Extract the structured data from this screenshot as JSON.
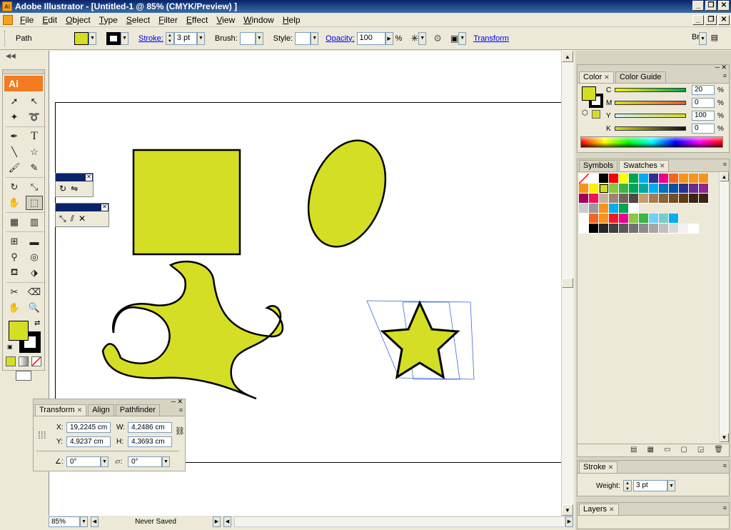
{
  "app": {
    "icon_text": "Ai",
    "title": "Adobe Illustrator - [Untitled-1 @ 85% (CMYK/Preview) ]"
  },
  "menu": [
    "File",
    "Edit",
    "Object",
    "Type",
    "Select",
    "Filter",
    "Effect",
    "View",
    "Window",
    "Help"
  ],
  "control_bar": {
    "selection": "Path",
    "stroke_label": "Stroke:",
    "stroke_value": "3 pt",
    "brush_label": "Brush:",
    "style_label": "Style:",
    "opacity_label": "Opacity:",
    "opacity_value": "100",
    "percent": "%",
    "transform_link": "Transform"
  },
  "colors": {
    "fill": "#d4de24",
    "stroke": "#000000",
    "accent": "#0a246a"
  },
  "tools": {
    "logo": "Ai",
    "icons": [
      "selection-tool",
      "direct-selection-tool",
      "magic-wand-tool",
      "lasso-tool",
      "pen-tool",
      "type-tool",
      "line-tool",
      "star-tool",
      "paintbrush-tool",
      "pencil-tool",
      "rotate-tool",
      "scale-tool",
      "warp-tool",
      "free-transform-tool",
      "symbol-sprayer-tool",
      "graph-tool",
      "mesh-tool",
      "gradient-tool",
      "eyedropper-tool",
      "blend-tool",
      "live-paint-tool",
      "live-paint-selection-tool",
      "slice-tool",
      "eraser-tool",
      "hand-tool",
      "zoom-tool"
    ]
  },
  "color_panel": {
    "tabs": [
      "Color",
      "Color Guide"
    ],
    "channels": [
      {
        "label": "C",
        "value": "20",
        "unit": "%"
      },
      {
        "label": "M",
        "value": "0",
        "unit": "%"
      },
      {
        "label": "Y",
        "value": "100",
        "unit": "%"
      },
      {
        "label": "K",
        "value": "0",
        "unit": "%"
      }
    ]
  },
  "swatches_panel": {
    "tabs": [
      "Symbols",
      "Swatches"
    ],
    "rows": [
      [
        "#ffffff",
        "#ffffff",
        "#000000",
        "#ff0000",
        "#ffff00",
        "#00a651",
        "#00aeef",
        "#2e3192",
        "#ec008c",
        "#f26522",
        "#f7941d",
        "#f7941d",
        "#f7941d"
      ],
      [
        "#f7941d",
        "#fff200",
        "#d4de24",
        "#8dc63f",
        "#39b54a",
        "#00a651",
        "#00a99d",
        "#00aeef",
        "#0072bc",
        "#0054a6",
        "#2e3192",
        "#662d91",
        "#92278f"
      ],
      [
        "#9e005d",
        "#ed145b",
        "#c7b299",
        "#998675",
        "#736357",
        "#534741",
        "#c69c6d",
        "#a67c52",
        "#8c6239",
        "#754c24",
        "#603913",
        "#3c2415",
        "#3c2415"
      ],
      [
        "#cccccc",
        "#999999",
        "#f7941d",
        "#00aeef",
        "#00a651",
        "#ffffff"
      ],
      [
        "#ffffff",
        "#f26522",
        "#f7941d",
        "#ed1c24",
        "#ec008c",
        "#8dc63f",
        "#39b54a",
        "#6dcff6",
        "#7accc8",
        "#00aeef"
      ],
      [
        "#ffffff",
        "#000000",
        "#262626",
        "#404040",
        "#595959",
        "#737373",
        "#8c8c8c",
        "#a6a6a6",
        "#bfbfbf",
        "#d9d9d9",
        "#f2f2f2",
        "#ffffff"
      ]
    ]
  },
  "stroke_panel": {
    "tab": "Stroke",
    "weight_label": "Weight:",
    "weight_value": "3 pt"
  },
  "layers_panel": {
    "tab": "Layers"
  },
  "transform_panel": {
    "tabs": [
      "Transform",
      "Align",
      "Pathfinder"
    ],
    "x_label": "X:",
    "x_value": "19,2245 cm",
    "y_label": "Y:",
    "y_value": "4,9237 cm",
    "w_label": "W:",
    "w_value": "4,2486 cm",
    "h_label": "H:",
    "h_value": "4,3693 cm",
    "rotate_value": "0°",
    "shear_value": "0°"
  },
  "status_bar": {
    "zoom": "85%",
    "status": "Never Saved"
  }
}
